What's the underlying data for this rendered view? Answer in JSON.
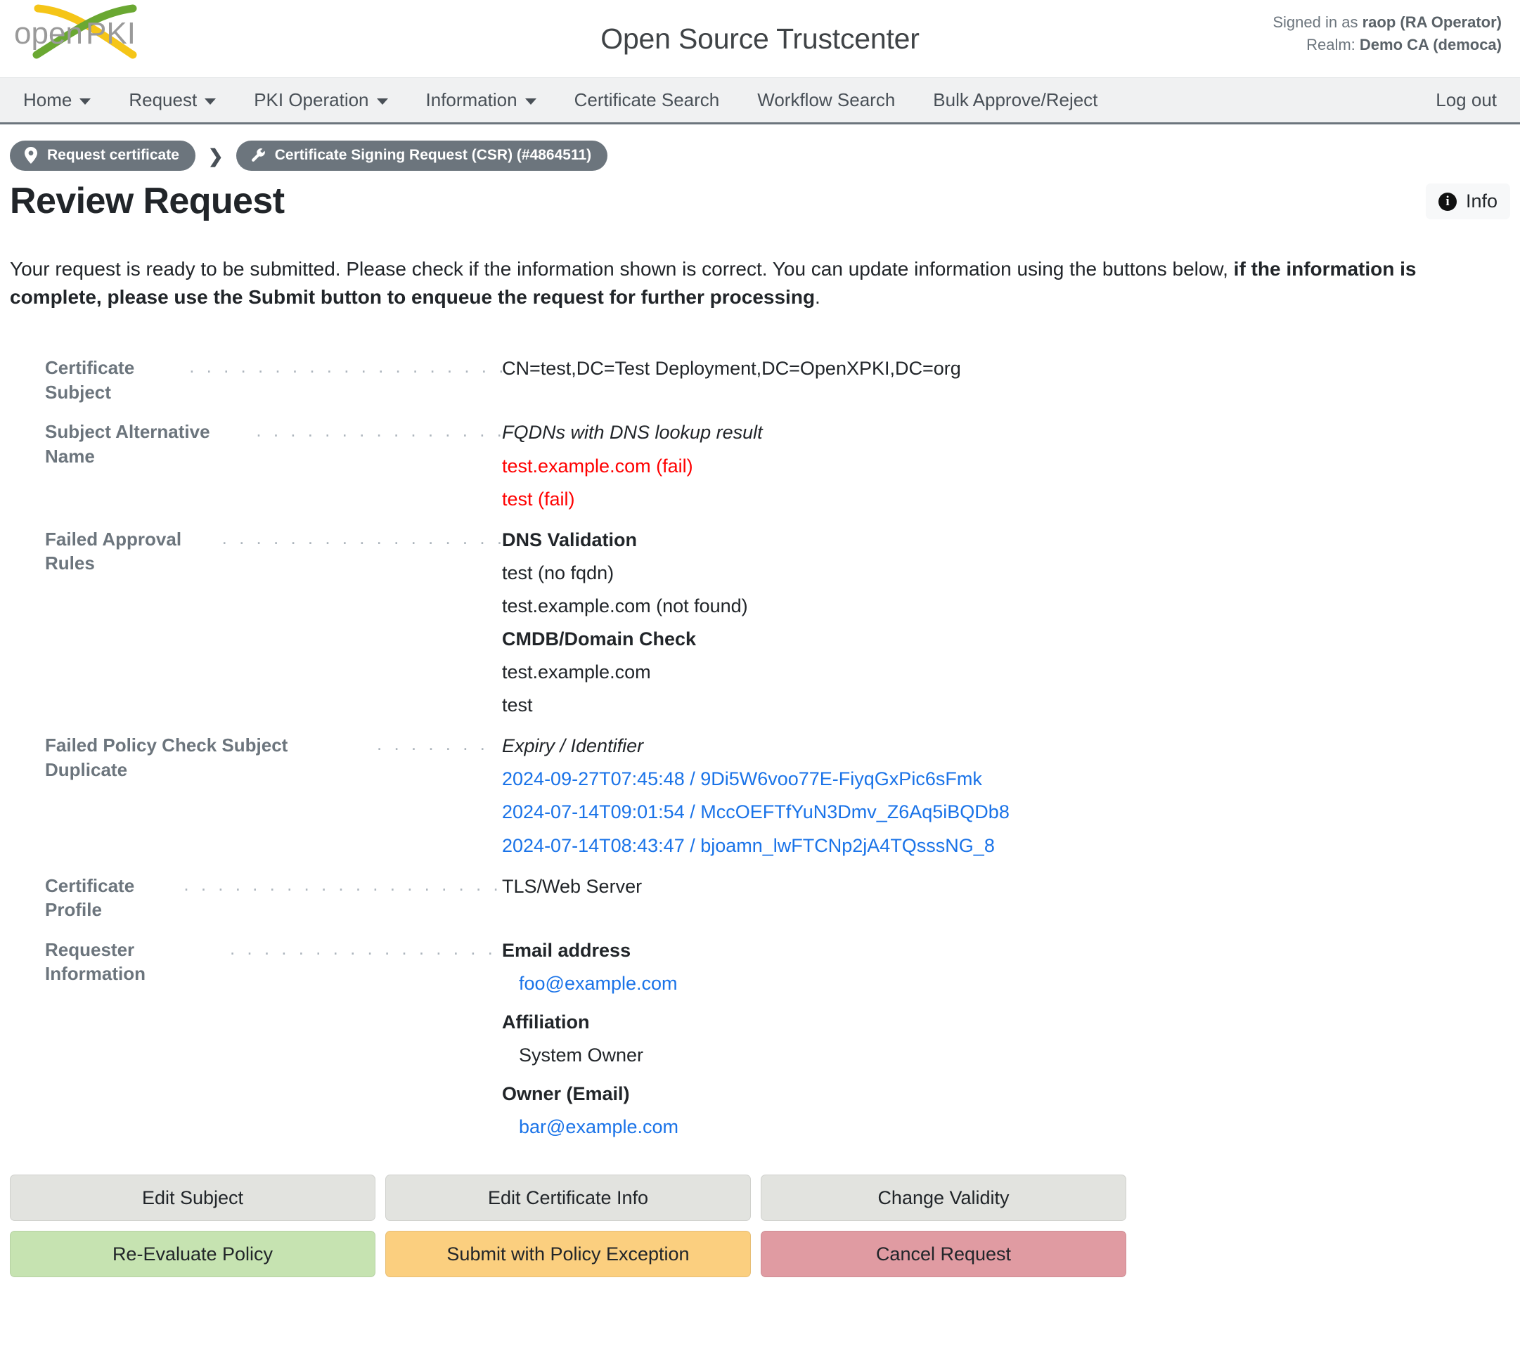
{
  "header": {
    "logo_alt": "OpenXPKI",
    "logo_text_left": "open",
    "logo_text_right": "PKI",
    "title": "Open Source Trustcenter",
    "signed_in_prefix": "Signed in as ",
    "signed_in_user": "raop (RA Operator)",
    "realm_prefix": "Realm: ",
    "realm_value": "Demo CA (democa)"
  },
  "nav": {
    "items": [
      {
        "label": "Home",
        "has_caret": true
      },
      {
        "label": "Request",
        "has_caret": true
      },
      {
        "label": "PKI Operation",
        "has_caret": true
      },
      {
        "label": "Information",
        "has_caret": true
      },
      {
        "label": "Certificate Search",
        "has_caret": false
      },
      {
        "label": "Workflow Search",
        "has_caret": false
      },
      {
        "label": "Bulk Approve/Reject",
        "has_caret": false
      },
      {
        "label": "Log out",
        "has_caret": false
      }
    ]
  },
  "breadcrumb": {
    "separator": "❯",
    "items": [
      {
        "label": "Request certificate",
        "icon": "map-pin-icon"
      },
      {
        "label": "Certificate Signing Request (CSR) (#4864511)",
        "icon": "wrench-icon"
      }
    ]
  },
  "page": {
    "title": "Review Request",
    "info_button_label": "Info",
    "intro_normal": "Your request is ready to be submitted. Please check if the information shown is correct. You can update information using the buttons below, ",
    "intro_bold": "if the information is complete, please use the Submit button to enqueue the request for further processing",
    "intro_tail": "."
  },
  "fields": [
    {
      "label": "Certificate Subject",
      "leader": ". . . . . . . . . . . . . . . . . . . . . .",
      "lines": [
        {
          "text": "CN=test,DC=Test Deployment,DC=OpenXPKI,DC=org",
          "style": "plain"
        }
      ]
    },
    {
      "label": "Subject Alternative Name",
      "leader": ". . . . . . . . . . . . . . . .",
      "lines": [
        {
          "text": "FQDNs with DNS lookup result",
          "style": "italic"
        },
        {
          "text": "test.example.com (fail)",
          "style": "fail"
        },
        {
          "text": "test (fail)",
          "style": "fail"
        }
      ]
    },
    {
      "label": "Failed Approval Rules",
      "leader": ". . . . . . . . . . . . . . . . . . .",
      "lines": [
        {
          "text": "DNS Validation",
          "style": "bold"
        },
        {
          "text": "test (no fqdn)",
          "style": "plain"
        },
        {
          "text": "test.example.com (not found)",
          "style": "plain"
        },
        {
          "text": "CMDB/Domain Check",
          "style": "bold"
        },
        {
          "text": "test.example.com",
          "style": "plain"
        },
        {
          "text": "test",
          "style": "plain"
        }
      ]
    },
    {
      "label": "Failed Policy Check Subject Duplicate",
      "leader": ". . . . . . .",
      "lines": [
        {
          "text": "Expiry / Identifier",
          "style": "italic"
        },
        {
          "text": "2024-09-27T07:45:48 / 9Di5W6voo77E-FiyqGxPic6sFmk",
          "style": "link"
        },
        {
          "text": "2024-07-14T09:01:54 / MccOEFTfYuN3Dmv_Z6Aq5iBQDb8",
          "style": "link"
        },
        {
          "text": "2024-07-14T08:43:47 / bjoamn_lwFTCNp2jA4TQsssNG_8",
          "style": "link"
        }
      ]
    },
    {
      "label": "Certificate Profile",
      "leader": ". . . . . . . . . . . . . . . . . . . . . .",
      "lines": [
        {
          "text": "TLS/Web Server",
          "style": "plain"
        }
      ]
    },
    {
      "label": "Requester Information",
      "leader": ". . . . . . . . . . . . . . . . . .",
      "lines": [
        {
          "text": "Email address",
          "style": "bold"
        },
        {
          "text": "foo@example.com",
          "style": "link-indent"
        },
        {
          "text": "Affiliation",
          "style": "bold-gap"
        },
        {
          "text": "System Owner",
          "style": "indent"
        },
        {
          "text": "Owner (Email)",
          "style": "bold-gap"
        },
        {
          "text": "bar@example.com",
          "style": "link-indent"
        }
      ]
    }
  ],
  "buttons": {
    "rows": [
      [
        {
          "label": "Edit Subject",
          "variant": "default",
          "name": "edit-subject-button"
        },
        {
          "label": "Edit Certificate Info",
          "variant": "default",
          "name": "edit-certificate-info-button"
        },
        {
          "label": "Change Validity",
          "variant": "default",
          "name": "change-validity-button"
        }
      ],
      [
        {
          "label": "Re-Evaluate Policy",
          "variant": "green",
          "name": "re-evaluate-policy-button"
        },
        {
          "label": "Submit with Policy Exception",
          "variant": "amber",
          "name": "submit-with-policy-exception-button"
        },
        {
          "label": "Cancel Request",
          "variant": "red",
          "name": "cancel-request-button"
        }
      ]
    ]
  },
  "colors": {
    "nav_background": "#f0f1f2",
    "nav_border": "#6c757d",
    "crumb_background": "#6c757d",
    "label_gray": "#6c757d",
    "fail_red": "#ff0000",
    "link_blue": "#1a73e8",
    "btn_default": "#e2e3df",
    "btn_green": "#c6e3b1",
    "btn_amber": "#fbcf7f",
    "btn_red": "#e09ba2",
    "logo_yellow": "#f5c518",
    "logo_green": "#6aa832",
    "logo_gray": "#9a9a9a"
  }
}
